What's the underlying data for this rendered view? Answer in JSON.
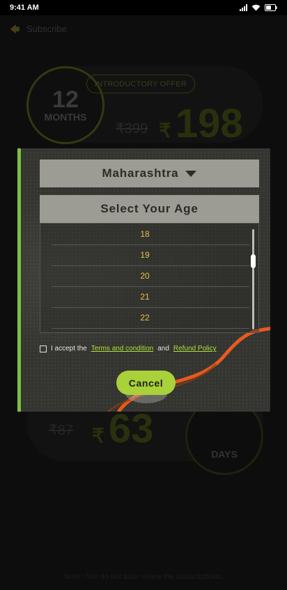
{
  "status_bar": {
    "time": "9:41 AM"
  },
  "header": {
    "back_label": "Subscribe"
  },
  "plan_12": {
    "number": "12",
    "unit": "MONTHS",
    "offer": "INTRODUCTORY OFFER",
    "old_price": "₹399",
    "currency": "₹",
    "price": "198"
  },
  "plan_days": {
    "old_price": "₹87",
    "currency": "₹",
    "price": "63",
    "unit": "DAYS"
  },
  "footer_note": "Note : We do not auto renew the subscriptions.",
  "modal": {
    "state_value": "Maharashtra",
    "age_header": "Select Your Age",
    "ages": [
      "18",
      "19",
      "20",
      "21",
      "22"
    ],
    "accept_prefix": "I accept the",
    "terms_link": "Terms and condition",
    "and_text": "and",
    "refund_link": "Refund Policy",
    "cancel_label": "Cancel"
  },
  "colors": {
    "accent": "#a8d13a",
    "age_text": "#e8c440",
    "link": "#aee03d",
    "swoosh": "#e65a1f"
  }
}
